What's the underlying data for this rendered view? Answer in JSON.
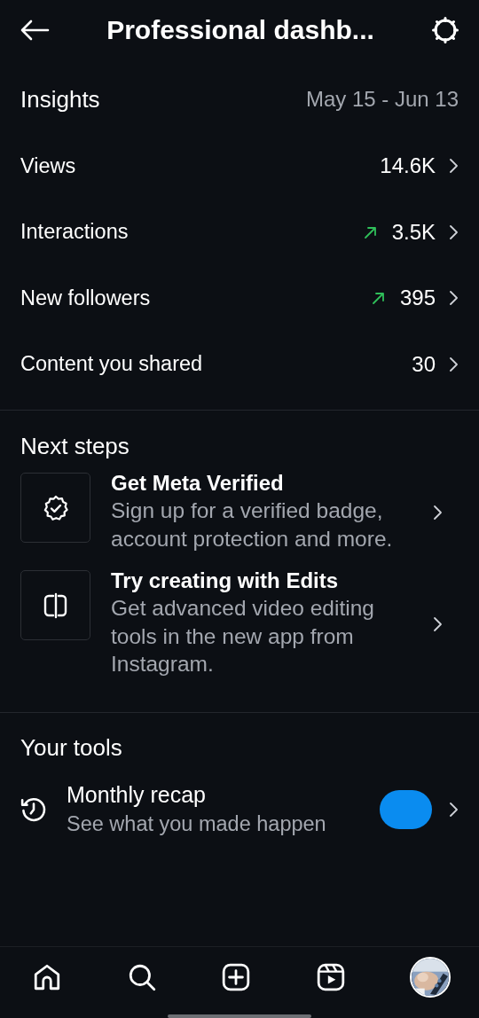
{
  "header": {
    "title": "Professional dashb..."
  },
  "insights": {
    "title": "Insights",
    "date_range": "May 15 - Jun 13",
    "rows": [
      {
        "label": "Views",
        "value": "14.6K",
        "trend_up": false
      },
      {
        "label": "Interactions",
        "value": "3.5K",
        "trend_up": true
      },
      {
        "label": "New followers",
        "value": "395",
        "trend_up": true
      },
      {
        "label": "Content you shared",
        "value": "30",
        "trend_up": false
      }
    ]
  },
  "next_steps": {
    "title": "Next steps",
    "items": [
      {
        "kind": "verified",
        "title": "Get Meta Verified",
        "description": "Sign up for a verified badge, account protection and more."
      },
      {
        "kind": "edits",
        "title": "Try creating with Edits",
        "description": "Get advanced video editing tools in the new app from Instagram."
      }
    ]
  },
  "tools": {
    "title": "Your tools",
    "items": [
      {
        "title": "Monthly recap",
        "description": "See what you made happen"
      }
    ]
  },
  "nav": [
    {
      "kind": "home",
      "selected": false
    },
    {
      "kind": "search",
      "selected": false
    },
    {
      "kind": "create",
      "selected": false
    },
    {
      "kind": "reels",
      "selected": false
    },
    {
      "kind": "profile",
      "selected": false
    }
  ]
}
